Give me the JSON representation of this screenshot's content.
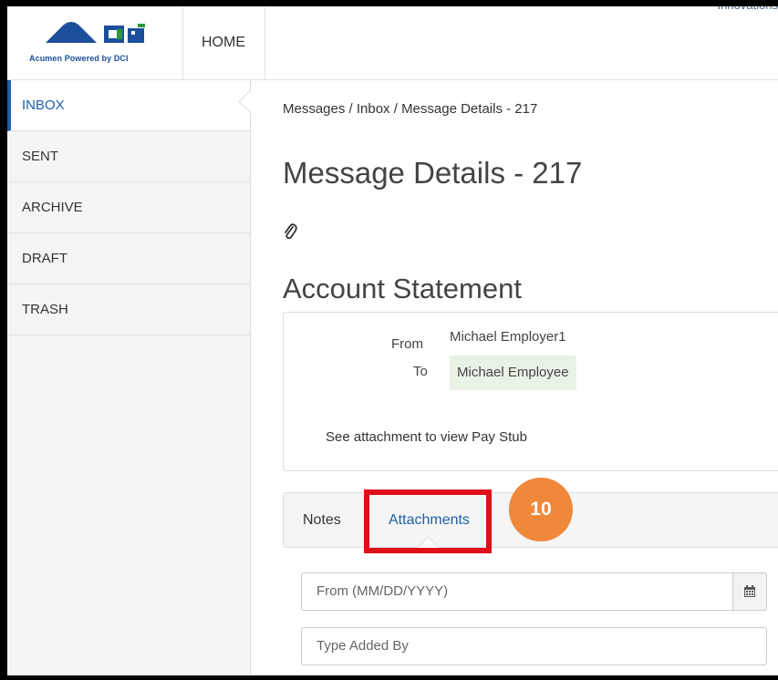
{
  "tagline": "Innovations",
  "header": {
    "logo_text": "Acumen Powered by DCI",
    "home_label": "HOME"
  },
  "sidebar": {
    "items": [
      {
        "label": "INBOX",
        "active": true
      },
      {
        "label": "SENT"
      },
      {
        "label": "ARCHIVE"
      },
      {
        "label": "DRAFT"
      },
      {
        "label": "TRASH"
      }
    ]
  },
  "breadcrumb": "Messages /  Inbox / Message Details - 217",
  "page_title": "Message Details - 217",
  "message": {
    "subject": "Account Statement",
    "from_label": "From",
    "from_value": "Michael Employer1",
    "to_label": "To",
    "to_value": "Michael Employee",
    "body": "See attachment to view Pay Stub"
  },
  "tabs": {
    "notes": "Notes",
    "attachments": "Attachments"
  },
  "step_badge": "10",
  "filters": {
    "from_placeholder": "From (MM/DD/YYYY)",
    "added_by_placeholder": "Type Added By"
  },
  "colors": {
    "accent": "#1f5fa6",
    "highlight": "#e0101b",
    "badge": "#f0883a",
    "to_chip": "#e8f3e6"
  },
  "icons": {
    "attachment": "paperclip-icon",
    "calendar": "calendar-icon"
  }
}
